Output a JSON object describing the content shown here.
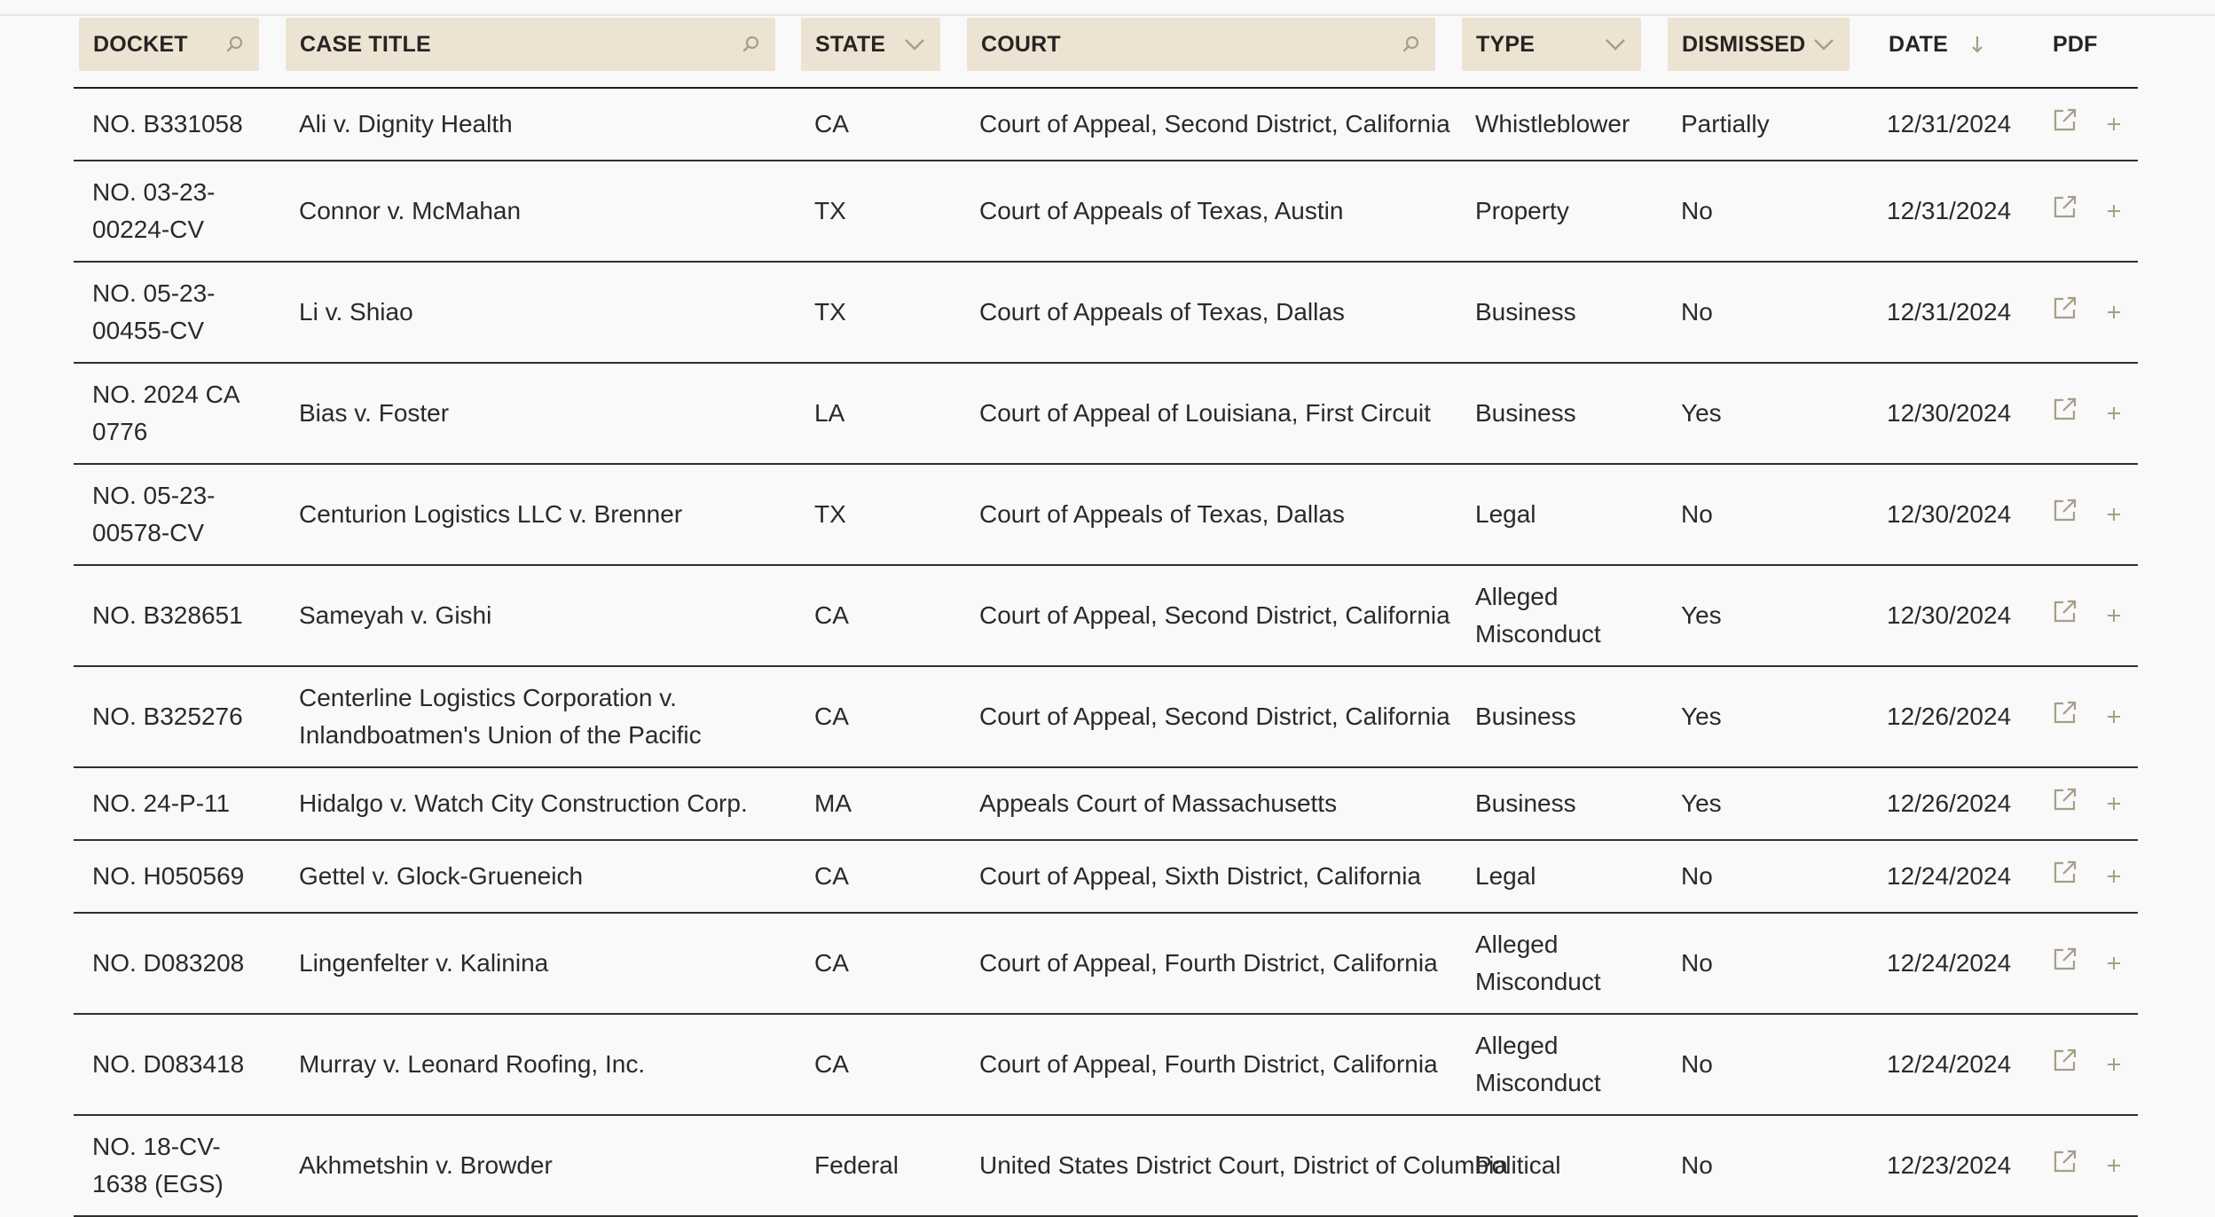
{
  "header": {
    "docket": "DOCKET",
    "case_title": "CASE TITLE",
    "state": "STATE",
    "court": "COURT",
    "type": "TYPE",
    "dismissed": "DISMISSED",
    "date": "DATE",
    "pdf": "PDF"
  },
  "icons": {
    "search": "search-icon",
    "dropdown": "chevron-down-icon",
    "sort": "arrow-down-icon",
    "open": "external-link-icon",
    "add": "plus-icon"
  },
  "colors": {
    "header_bg": "#ece3d2",
    "icon": "#a89d86",
    "text": "#2b2a28"
  },
  "rows": [
    {
      "docket": "NO. B331058",
      "title": "Ali v. Dignity Health",
      "state": "CA",
      "court": "Court of Appeal, Second District, California",
      "type": "Whistleblower",
      "dismissed": "Partially",
      "date": "12/31/2024"
    },
    {
      "docket": "NO. 03-23-00224-CV",
      "title": "Connor v. McMahan",
      "state": "TX",
      "court": "Court of Appeals of Texas, Austin",
      "type": "Property",
      "dismissed": "No",
      "date": "12/31/2024"
    },
    {
      "docket": "NO. 05-23-00455-CV",
      "title": "Li v. Shiao",
      "state": "TX",
      "court": "Court of Appeals of Texas, Dallas",
      "type": "Business",
      "dismissed": "No",
      "date": "12/31/2024"
    },
    {
      "docket": "NO. 2024 CA 0776",
      "title": "Bias v. Foster",
      "state": "LA",
      "court": "Court of Appeal of Louisiana, First Circuit",
      "type": "Business",
      "dismissed": "Yes",
      "date": "12/30/2024"
    },
    {
      "docket": "NO. 05-23-00578-CV",
      "title": "Centurion Logistics LLC v. Brenner",
      "state": "TX",
      "court": "Court of Appeals of Texas, Dallas",
      "type": "Legal",
      "dismissed": "No",
      "date": "12/30/2024"
    },
    {
      "docket": "NO. B328651",
      "title": "Sameyah v. Gishi",
      "state": "CA",
      "court": "Court of Appeal, Second District, California",
      "type": "Alleged Misconduct",
      "dismissed": "Yes",
      "date": "12/30/2024"
    },
    {
      "docket": "NO. B325276",
      "title": "Centerline Logistics Corporation v. Inlandboatmen's Union of the Pacific",
      "state": "CA",
      "court": "Court of Appeal, Second District, California",
      "type": "Business",
      "dismissed": "Yes",
      "date": "12/26/2024"
    },
    {
      "docket": "NO. 24-P-11",
      "title": "Hidalgo v. Watch City Construction Corp.",
      "state": "MA",
      "court": "Appeals Court of Massachusetts",
      "type": "Business",
      "dismissed": "Yes",
      "date": "12/26/2024"
    },
    {
      "docket": "NO. H050569",
      "title": "Gettel v. Glock-Grueneich",
      "state": "CA",
      "court": "Court of Appeal, Sixth District, California",
      "type": "Legal",
      "dismissed": "No",
      "date": "12/24/2024"
    },
    {
      "docket": "NO. D083208",
      "title": "Lingenfelter v. Kalinina",
      "state": "CA",
      "court": "Court of Appeal, Fourth District, California",
      "type": "Alleged Misconduct",
      "dismissed": "No",
      "date": "12/24/2024"
    },
    {
      "docket": "NO. D083418",
      "title": "Murray v. Leonard Roofing, Inc.",
      "state": "CA",
      "court": "Court of Appeal, Fourth District, California",
      "type": "Alleged Misconduct",
      "dismissed": "No",
      "date": "12/24/2024"
    },
    {
      "docket": "NO. 18-CV-1638 (EGS)",
      "title": "Akhmetshin v. Browder",
      "state": "Federal",
      "court": "United States District Court, District of Columbia",
      "type": "Political",
      "dismissed": "No",
      "date": "12/23/2024"
    }
  ]
}
